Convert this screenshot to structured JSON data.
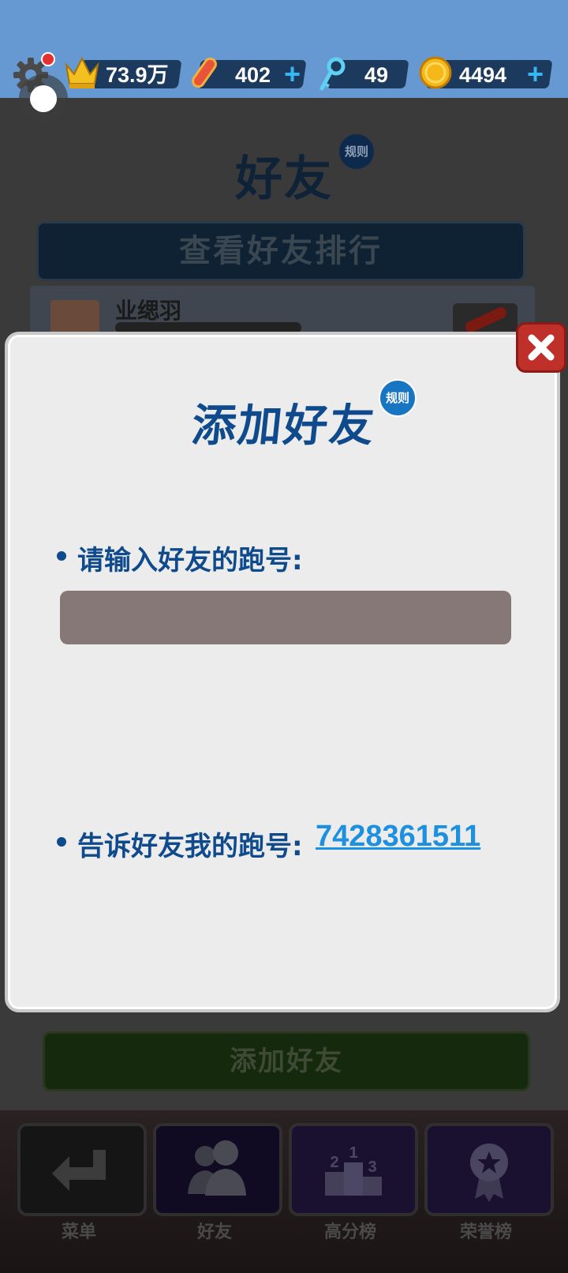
{
  "hud": {
    "crown_value": "73.9万",
    "hoverboards": "402",
    "keys": "49",
    "coins": "4494",
    "plus": "+",
    "notification_dot_color": "#e53030"
  },
  "background_page": {
    "title": "好友",
    "rules_badge": "规则",
    "ranking_button": "查看好友排行",
    "friend_row": {
      "name": "业缌羽"
    },
    "add_friend_button": "添加好友"
  },
  "modal": {
    "title": "添加好友",
    "rules_badge": "规则",
    "prompt_label": "请输入好友的跑号:",
    "input": {
      "value": "",
      "placeholder": ""
    },
    "tell_label": "告诉好友我的跑号:",
    "my_id": "7428361511",
    "close_icon": "close-x-icon"
  },
  "bottom_nav": {
    "items": [
      {
        "label": "菜单",
        "icon": "return-arrow-icon"
      },
      {
        "label": "好友",
        "icon": "people-icon"
      },
      {
        "label": "高分榜",
        "icon": "podium-icon"
      },
      {
        "label": "荣誉榜",
        "icon": "award-badge-icon"
      }
    ]
  },
  "colors": {
    "hud_bg": "#6699d1",
    "title_blue": "#0f4a8c",
    "link_blue": "#1e90e0",
    "input_bg": "#857877",
    "close_red": "#c0302b"
  }
}
